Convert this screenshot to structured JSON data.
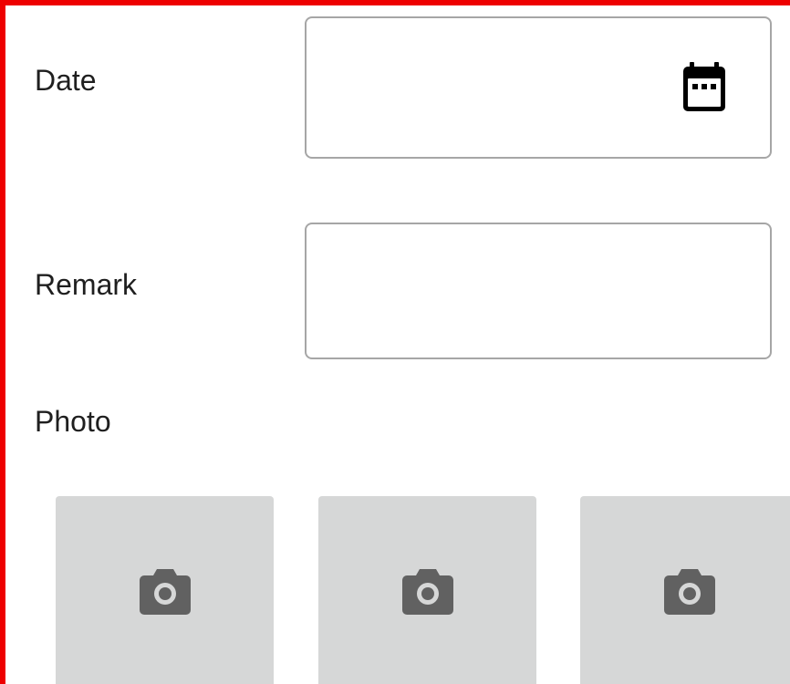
{
  "form": {
    "date": {
      "label": "Date",
      "value": "",
      "icon": "calendar-icon"
    },
    "remark": {
      "label": "Remark",
      "value": ""
    },
    "photo": {
      "label": "Photo",
      "slots": [
        {
          "icon": "camera-icon"
        },
        {
          "icon": "camera-icon"
        },
        {
          "icon": "camera-icon"
        }
      ]
    }
  },
  "colors": {
    "frame_border": "#ee0000",
    "field_border": "#a6a6a6",
    "photo_slot_bg": "#d6d7d7",
    "camera_icon": "#616161",
    "calendar_icon": "#000000",
    "label_text": "#1f1f1f"
  }
}
